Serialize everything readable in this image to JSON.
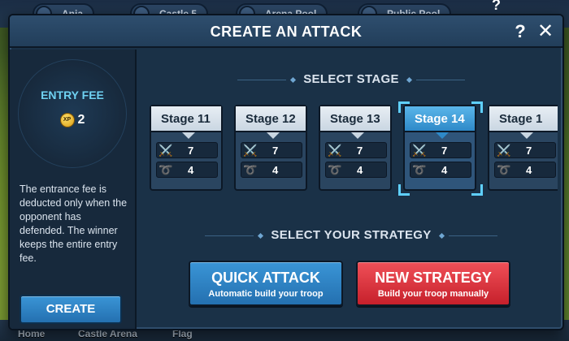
{
  "background": {
    "top_items": [
      "Anja",
      "Castle 5",
      "Arena Pool",
      "Public Pool"
    ],
    "top_help": "?",
    "bottom_items": [
      "Home",
      "Castle Arena",
      "Flag"
    ]
  },
  "modal": {
    "title": "CREATE AN ATTACK",
    "help_label": "?",
    "close_label": "✕"
  },
  "entry_fee": {
    "label": "ENTRY FEE",
    "currency": "XP",
    "value": "2",
    "description": "The entrance fee is deducted only when the opponent has defended. The winner keeps the entire entry fee.",
    "create_button": "CREATE"
  },
  "select_stage": {
    "title": "SELECT STAGE",
    "selected_index": 3,
    "stages": [
      {
        "name": "Stage 11",
        "attack": "7",
        "defense": "4"
      },
      {
        "name": "Stage 12",
        "attack": "7",
        "defense": "4"
      },
      {
        "name": "Stage 13",
        "attack": "7",
        "defense": "4"
      },
      {
        "name": "Stage 14",
        "attack": "7",
        "defense": "4"
      },
      {
        "name": "Stage 1",
        "attack": "7",
        "defense": "4"
      }
    ],
    "attack_icon": "crossed-swords-icon",
    "defense_icon": "horn-icon"
  },
  "strategy": {
    "title": "SELECT YOUR STRATEGY",
    "quick": {
      "label": "QUICK ATTACK",
      "sub": "Automatic build your troop"
    },
    "new": {
      "label": "NEW STRATEGY",
      "sub": "Build your troop manually"
    }
  },
  "colors": {
    "accent_blue": "#2f8ccc",
    "accent_red": "#d42b36",
    "fee_label": "#6fd2f2",
    "selection": "#5fd0ff"
  }
}
